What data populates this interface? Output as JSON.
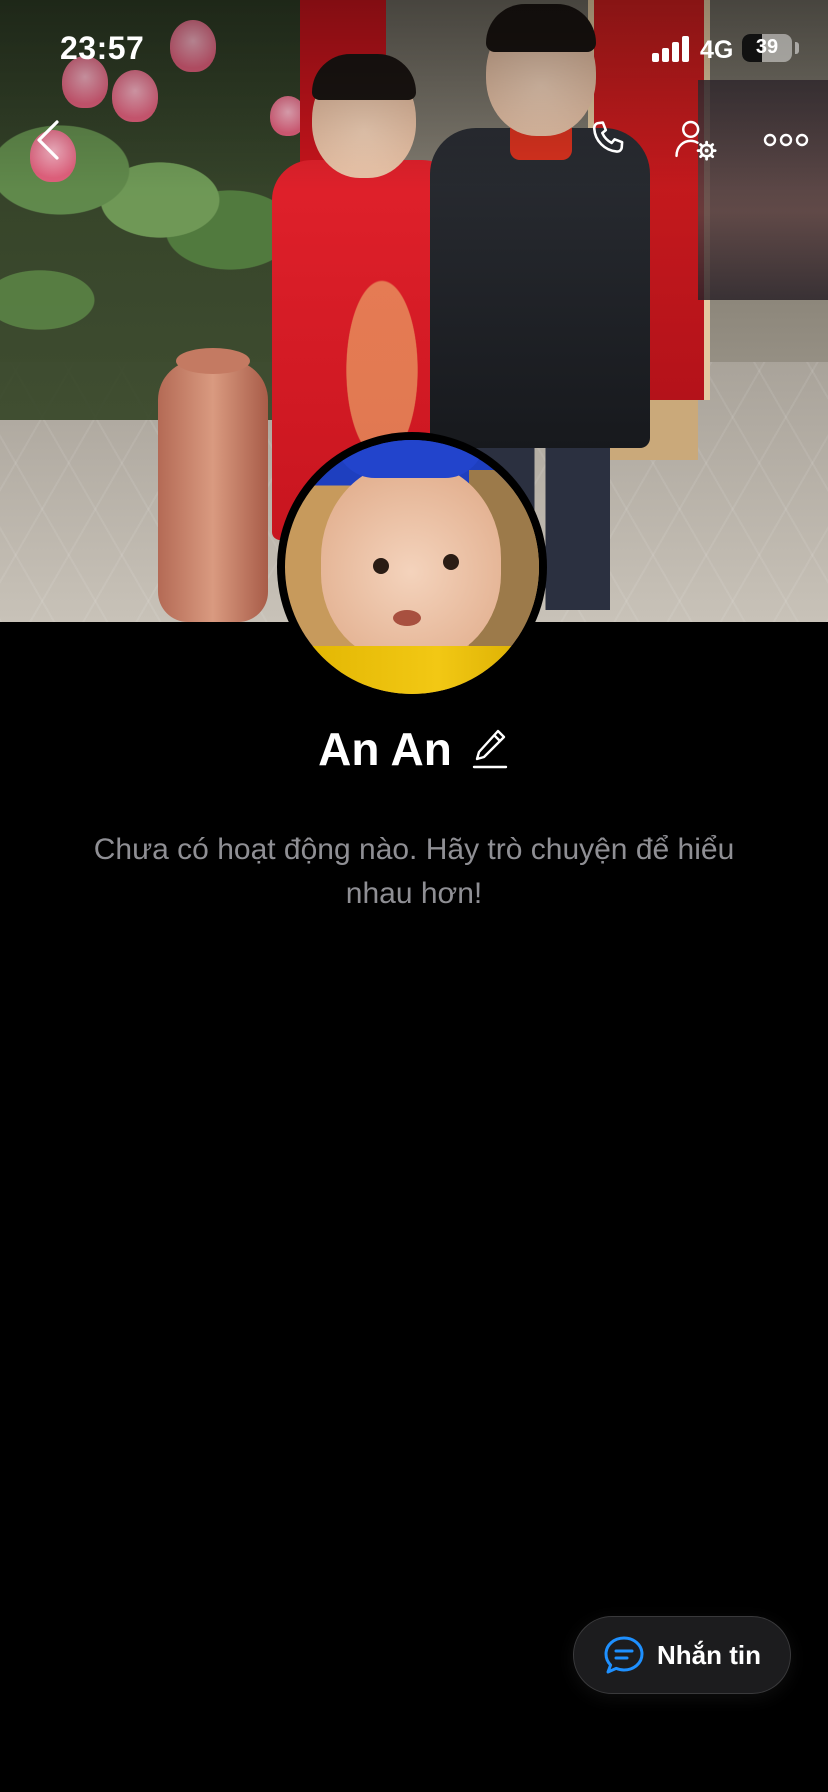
{
  "status_bar": {
    "time": "23:57",
    "network": "4G",
    "battery": "39",
    "battery_level": 0.39
  },
  "nav": {
    "back_icon": "chevron-left-icon",
    "call_icon": "phone-icon",
    "settings_icon": "user-settings-icon",
    "more_icon": "more-horizontal-icon"
  },
  "profile": {
    "name": "An An",
    "edit_icon": "pencil-icon",
    "empty_message": "Chưa có hoạt động nào. Hãy trò chuyện để hiểu nhau hơn!"
  },
  "actions": {
    "message_label": "Nhắn tin",
    "message_icon": "chat-bubble-icon",
    "accent_color": "#1e90ff"
  }
}
